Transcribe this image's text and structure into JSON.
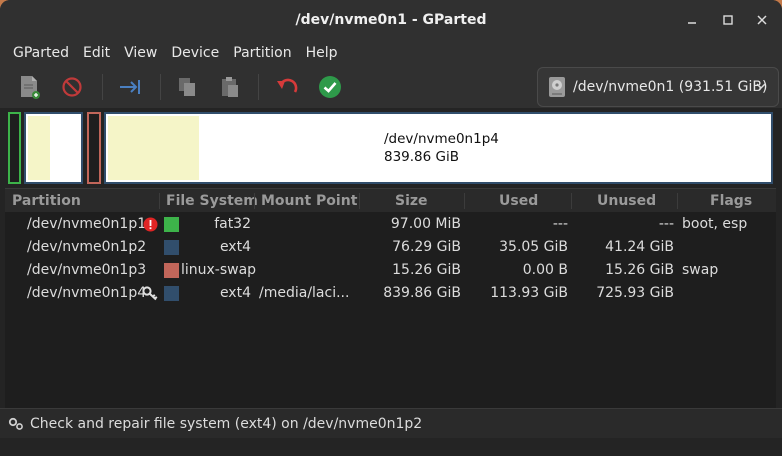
{
  "window": {
    "title": "/dev/nvme0n1 - GParted"
  },
  "menu": [
    "GParted",
    "Edit",
    "View",
    "Device",
    "Partition",
    "Help"
  ],
  "device_selector": {
    "label": "/dev/nvme0n1 (931.51 GiB)"
  },
  "map_summary": {
    "name": "/dev/nvme0n1p4",
    "size": "839.86 GiB"
  },
  "columns": [
    "Partition",
    "File System",
    "Mount Point",
    "Size",
    "Used",
    "Unused",
    "Flags"
  ],
  "rows": [
    {
      "partition": "/dev/nvme0n1p1",
      "fs": "fat32",
      "fs_color": "#3db34a",
      "mount": "",
      "size": "97.00 MiB",
      "used": "---",
      "unused": "---",
      "flags": "boot, esp",
      "badge": "warning"
    },
    {
      "partition": "/dev/nvme0n1p2",
      "fs": "ext4",
      "fs_color": "#314e6c",
      "mount": "",
      "size": "76.29 GiB",
      "used": "35.05 GiB",
      "unused": "41.24 GiB",
      "flags": "",
      "badge": ""
    },
    {
      "partition": "/dev/nvme0n1p3",
      "fs": "linux-swap",
      "fs_color": "#c1665a",
      "mount": "",
      "size": "15.26 GiB",
      "used": "0.00 B",
      "unused": "15.26 GiB",
      "flags": "swap",
      "badge": ""
    },
    {
      "partition": "/dev/nvme0n1p4",
      "fs": "ext4",
      "fs_color": "#314e6c",
      "mount": "/media/laci...",
      "size": "839.86 GiB",
      "used": "113.93 GiB",
      "unused": "725.93 GiB",
      "flags": "",
      "badge": "key"
    }
  ],
  "status": {
    "text": "Check and repair file system (ext4) on /dev/nvme0n1p2"
  },
  "colors": {
    "titlebar": "#303030",
    "body": "#242424",
    "fat32": "#3db34a",
    "ext4": "#314e6c",
    "swap": "#c1665a",
    "used_fill": "#f5f5c8"
  }
}
